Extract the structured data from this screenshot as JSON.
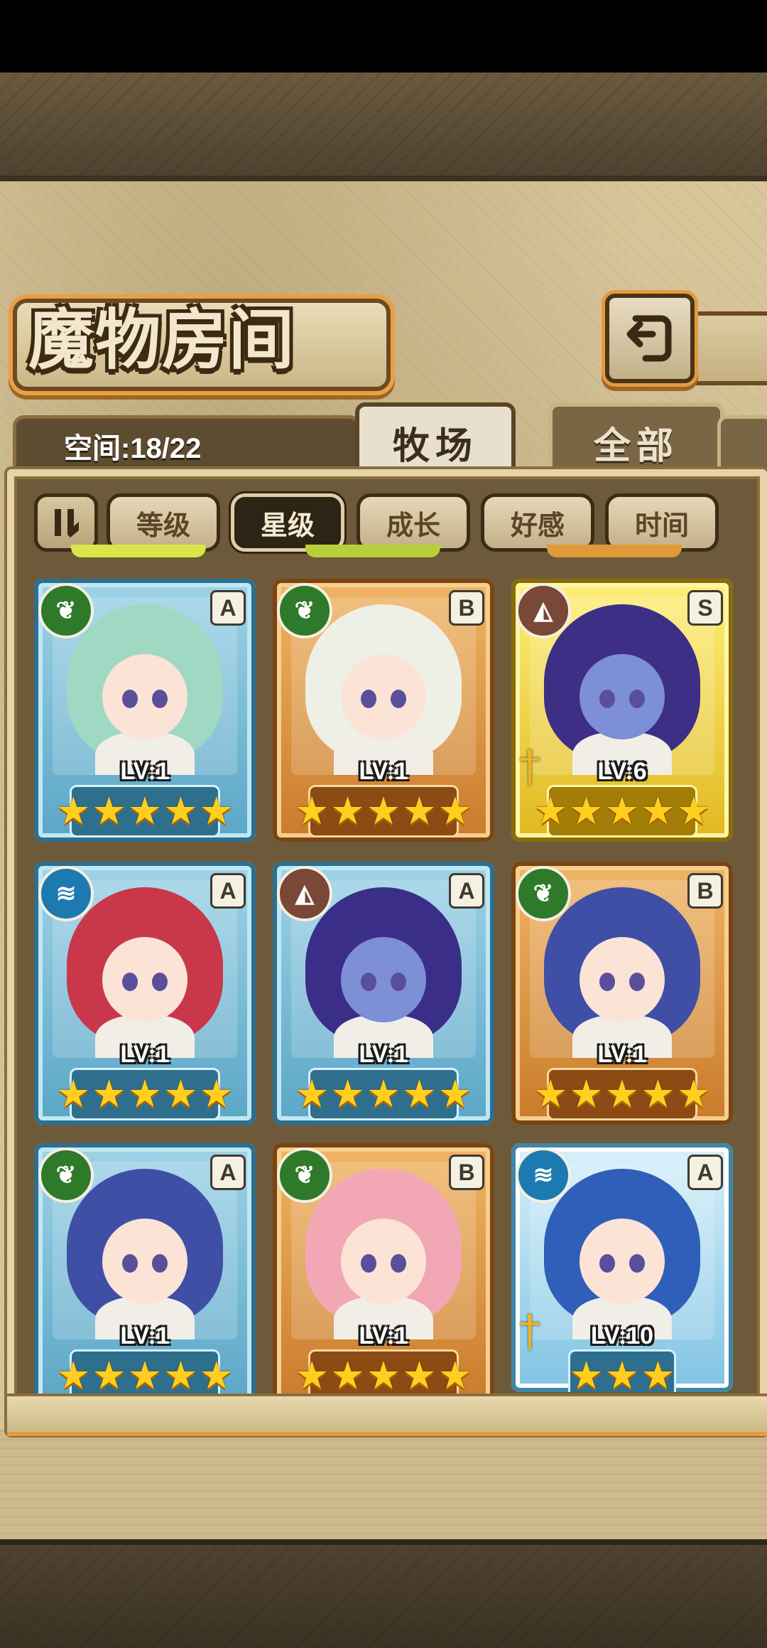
{
  "title": "魔物房间",
  "space_label": "空间:18/22",
  "tabs": [
    {
      "label": "牧场",
      "active": true
    },
    {
      "label": "全部",
      "active": false
    }
  ],
  "sort_buttons": [
    {
      "label": "等级",
      "selected": false
    },
    {
      "label": "星级",
      "selected": true
    },
    {
      "label": "成长",
      "selected": false
    },
    {
      "label": "好感",
      "selected": false
    },
    {
      "label": "时间",
      "selected": false
    }
  ],
  "icons": {
    "back": "back-arrow-icon",
    "sort_toggle": "sort-order-icon",
    "star": "★",
    "sword": "sword-icon"
  },
  "colors": {
    "frame_blue": "#5aa6c6",
    "frame_bronze": "#c97b2a",
    "frame_gold": "#e0b820",
    "star": "#ffcf1f"
  },
  "monsters": [
    {
      "element": "nature",
      "element_glyph": "❦",
      "rank": "A",
      "level": "LV:1",
      "stars": 5,
      "frame": "blue",
      "hair": "#9fd8c3",
      "equipped": false
    },
    {
      "element": "nature",
      "element_glyph": "❦",
      "rank": "B",
      "level": "LV:1",
      "stars": 5,
      "frame": "bronze",
      "hair": "#eef0e6",
      "equipped": false
    },
    {
      "element": "earth",
      "element_glyph": "◭",
      "rank": "S",
      "level": "LV:6",
      "stars": 5,
      "frame": "gold",
      "hair": "#3d2f86",
      "equipped": true
    },
    {
      "element": "water",
      "element_glyph": "≋",
      "rank": "A",
      "level": "LV:1",
      "stars": 5,
      "frame": "blue",
      "hair": "#c9384a",
      "equipped": false
    },
    {
      "element": "earth",
      "element_glyph": "◭",
      "rank": "A",
      "level": "LV:1",
      "stars": 5,
      "frame": "blue",
      "hair": "#3a2e88",
      "equipped": false
    },
    {
      "element": "nature",
      "element_glyph": "❦",
      "rank": "B",
      "level": "LV:1",
      "stars": 5,
      "frame": "bronze",
      "hair": "#3f4fa6",
      "equipped": false
    },
    {
      "element": "nature",
      "element_glyph": "❦",
      "rank": "A",
      "level": "LV:1",
      "stars": 5,
      "frame": "blue",
      "hair": "#3f4fa6",
      "equipped": false
    },
    {
      "element": "nature",
      "element_glyph": "❦",
      "rank": "B",
      "level": "LV:1",
      "stars": 5,
      "frame": "bronze",
      "hair": "#f2a8b4",
      "equipped": false
    },
    {
      "element": "water",
      "element_glyph": "≋",
      "rank": "A",
      "level": "LV:10",
      "stars": 3,
      "frame": "ice",
      "hair": "#2f5fb8",
      "equipped": true
    }
  ]
}
